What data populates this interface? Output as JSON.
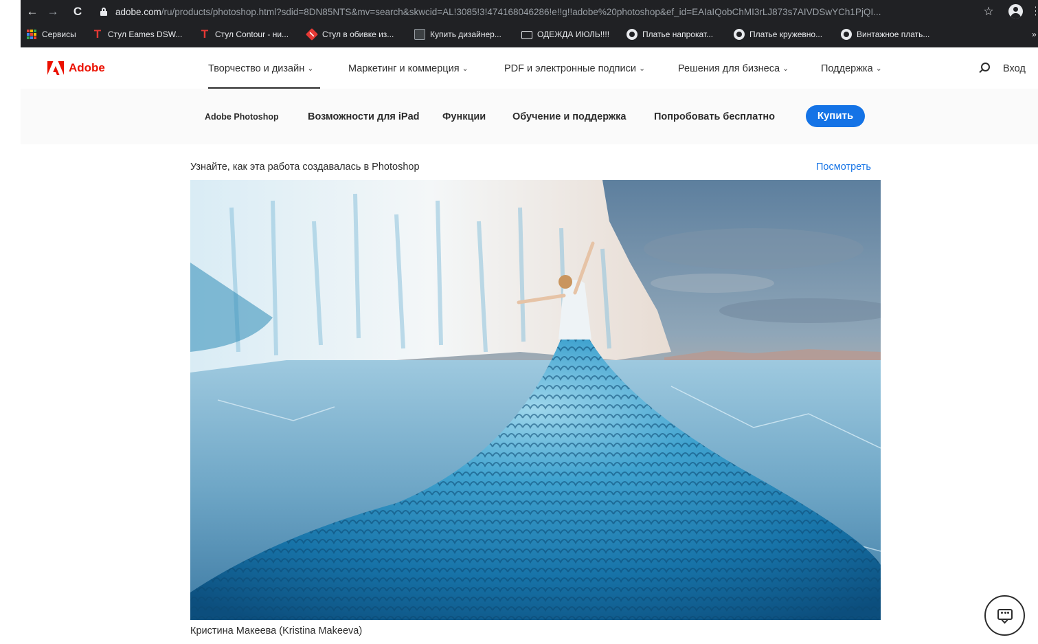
{
  "browser": {
    "url_host": "adobe.com",
    "url_rest": "/ru/products/photoshop.html?sdid=8DN85NTS&mv=search&skwcid=AL!3085!3!474168046286!e!!g!!adobe%20photoshop&ef_id=EAIaIQobChMI3rLJ873s7AIVDSwYCh1PjQI...",
    "bookmarks": [
      {
        "label": "Сервисы",
        "icon": "apps-grid-icon"
      },
      {
        "label": "Стул Eames DSW...",
        "icon": "t-logo-icon"
      },
      {
        "label": "Стул Contour - ни...",
        "icon": "t-logo-icon"
      },
      {
        "label": "Стул в обивке из...",
        "icon": "diamond-logo-icon"
      },
      {
        "label": "Купить дизайнер...",
        "icon": "site-favicon-icon"
      },
      {
        "label": "ОДЕЖДА ИЮЛЬ!!!!",
        "icon": "folder-icon"
      },
      {
        "label": "Платье напрокат...",
        "icon": "globe-icon"
      },
      {
        "label": "Платье кружевно...",
        "icon": "globe-icon"
      },
      {
        "label": "Винтажное плать...",
        "icon": "globe-icon"
      }
    ]
  },
  "gnav": {
    "brand": "Adobe",
    "items": [
      "Творчество и дизайн",
      "Маркетинг и коммерция",
      "PDF и электронные подписи",
      "Решения для бизнеса",
      "Поддержка"
    ],
    "signin": "Вход"
  },
  "subnav": {
    "product": "Adobe Photoshop",
    "items": [
      "Возможности для iPad",
      "Функции",
      "Обучение и поддержка",
      "Попробовать бесплатно"
    ],
    "buy": "Купить"
  },
  "content": {
    "learn_text": "Узнайте, как эта работа создавалась в Photoshop",
    "watch_link": "Посмотреть",
    "caption": "Кристина Макеева (Kristina Makeeva)"
  },
  "colors": {
    "adobe_red": "#eb1000",
    "link_blue": "#1473e6",
    "button_blue": "#1473e6"
  }
}
